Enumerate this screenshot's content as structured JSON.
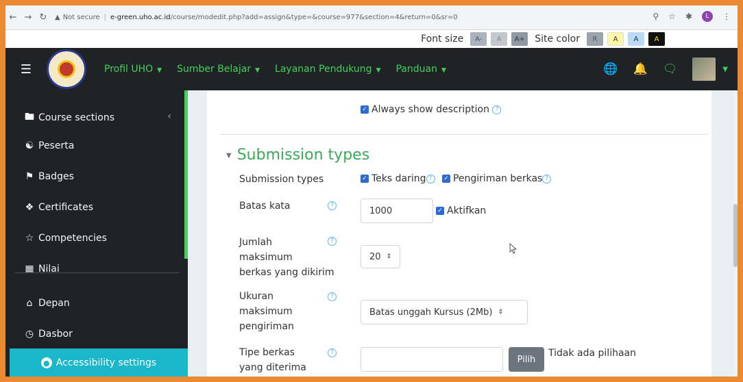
{
  "browser": {
    "security_label": "Not secure",
    "url_host": "e-green.uho.ac.id",
    "url_path": "/course/modedit.php?add=assign&type=&course=977&section=4&return=0&sr=0",
    "profile_initial": "L"
  },
  "a11y_bar": {
    "font_size_label": "Font size",
    "font_buttons": [
      "A-",
      "A",
      "A+"
    ],
    "site_color_label": "Site color",
    "color_buttons": [
      "R",
      "A",
      "A",
      "A"
    ]
  },
  "topnav": {
    "menu": [
      {
        "label": "Profil UHO"
      },
      {
        "label": "Sumber Belajar"
      },
      {
        "label": "Layanan Pendukung"
      },
      {
        "label": "Panduan"
      }
    ]
  },
  "drawer": {
    "items": [
      {
        "label": "Course sections",
        "icon": "folder-icon"
      },
      {
        "label": "Peserta",
        "icon": "users-icon"
      },
      {
        "label": "Badges",
        "icon": "badge-icon"
      },
      {
        "label": "Certificates",
        "icon": "certificate-icon"
      },
      {
        "label": "Competencies",
        "icon": "star-icon"
      },
      {
        "label": "Nilai",
        "icon": "gradebook-icon"
      },
      {
        "label": "Depan",
        "icon": "home-icon"
      },
      {
        "label": "Dasbor",
        "icon": "dashboard-icon"
      }
    ],
    "accessibility_settings": "Accessibility settings"
  },
  "form": {
    "always_show_description": "Always show description",
    "section_title": "Submission types",
    "submission_types": {
      "label": "Submission types",
      "option1": "Teks daring",
      "option2": "Pengiriman berkas"
    },
    "batas_kata": {
      "label": "Batas kata",
      "value": "1000",
      "enable_label": "Aktifkan"
    },
    "jumlah": {
      "label_line1": "Jumlah",
      "label_line2": "maksimum",
      "label_line3": "berkas yang dikirim",
      "value": "20"
    },
    "ukuran": {
      "label_line1": "Ukuran",
      "label_line2": "maksimum",
      "label_line3": "pengiriman",
      "value": "Batas unggah Kursus (2Mb)"
    },
    "tipe": {
      "label_line1": "Tipe berkas",
      "label_line2": "yang diterima",
      "button": "Pilih",
      "none_text": "Tidak ada pilihaan"
    }
  }
}
